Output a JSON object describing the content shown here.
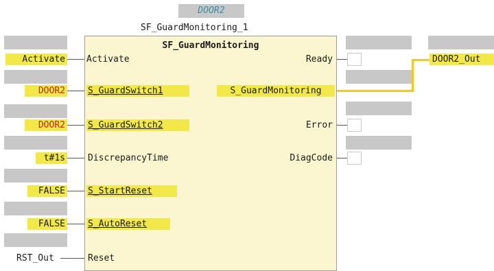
{
  "instance": {
    "variable": "DOOR2",
    "name": "SF_GuardMonitoring_1",
    "type": "SF_GuardMonitoring"
  },
  "inputs": [
    {
      "actual": "Activate",
      "formal": "Activate"
    },
    {
      "actual": "DOOR2",
      "formal": "S_GuardSwitch1"
    },
    {
      "actual": "DOOR2",
      "formal": "S_GuardSwitch2"
    },
    {
      "actual": "t#1s",
      "formal": "DiscrepancyTime"
    },
    {
      "actual": "FALSE",
      "formal": "S_StartReset"
    },
    {
      "actual": "FALSE",
      "formal": "S_AutoReset"
    },
    {
      "actual": "RST_Out",
      "formal": "Reset"
    }
  ],
  "outputs": [
    {
      "formal": "Ready"
    },
    {
      "formal": "S_GuardMonitoring",
      "actual": "DOOR2_Out"
    },
    {
      "formal": "Error"
    },
    {
      "formal": "DiagCode"
    }
  ],
  "colors": {
    "highlight": "#f2e84a",
    "block_fill": "#fbf6cf",
    "signal_wire": "#f5c431",
    "safety_text": "#cc1f1f",
    "placeholder": "#c8c8c8"
  }
}
